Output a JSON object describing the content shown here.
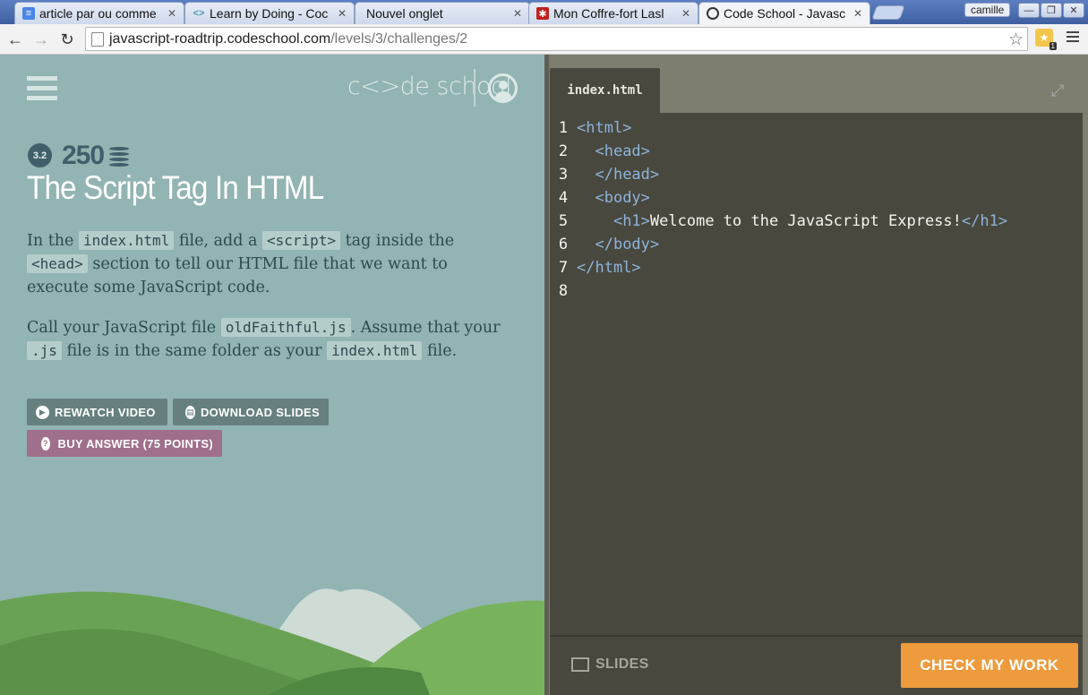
{
  "browser": {
    "tabs": [
      {
        "title": "article par ou comme",
        "favicon": "docs-icon"
      },
      {
        "title": "Learn by Doing - Coc",
        "favicon": "code-icon"
      },
      {
        "title": "Nouvel onglet",
        "favicon": ""
      },
      {
        "title": "Mon Coffre-fort Lasl",
        "favicon": "lastpass-icon"
      },
      {
        "title": "Code School - Javasc",
        "favicon": "codeschool-icon"
      }
    ],
    "user": "camille",
    "url_host": "javascript-roadtrip.codeschool.com",
    "url_path": "/levels/3/challenges/2",
    "extension_count": "1"
  },
  "header": {
    "brand": "c<>de school"
  },
  "challenge": {
    "level": "3.2",
    "points": "250",
    "title": "The Script Tag In HTML",
    "p1": {
      "t1": "In the ",
      "c1": "index.html",
      "t2": " file, add a ",
      "c2": "<script>",
      "t3": " tag inside the ",
      "c3": "<head>",
      "t4": " section to tell our HTML file that we want to execute some JavaScript code."
    },
    "p2": {
      "t1": "Call your JavaScript file ",
      "c1": "oldFaithful.js",
      "t2": ". Assume that your ",
      "c2": ".js",
      "t3": " file is in the same folder as your ",
      "c3": "index.html",
      "t4": " file."
    }
  },
  "actions": {
    "rewatch": "REWATCH VIDEO",
    "download": "DOWNLOAD SLIDES",
    "buy": "BUY ANSWER (75 POINTS)"
  },
  "editor": {
    "file_tab": "index.html",
    "lines": [
      {
        "n": "1",
        "indent": "",
        "open": "<html>",
        "text": "",
        "close": ""
      },
      {
        "n": "2",
        "indent": "  ",
        "open": "<head>",
        "text": "",
        "close": ""
      },
      {
        "n": "3",
        "indent": "  ",
        "open": "</head>",
        "text": "",
        "close": ""
      },
      {
        "n": "4",
        "indent": "  ",
        "open": "<body>",
        "text": "",
        "close": ""
      },
      {
        "n": "5",
        "indent": "    ",
        "open": "<h1>",
        "text": "Welcome to the JavaScript Express!",
        "close": "</h1>"
      },
      {
        "n": "6",
        "indent": "  ",
        "open": "</body>",
        "text": "",
        "close": ""
      },
      {
        "n": "7",
        "indent": "",
        "open": "</html>",
        "text": "",
        "close": ""
      },
      {
        "n": "8",
        "indent": "",
        "open": "",
        "text": "",
        "close": ""
      }
    ],
    "slides_label": "SLIDES",
    "check_label": "CHECK MY WORK"
  }
}
